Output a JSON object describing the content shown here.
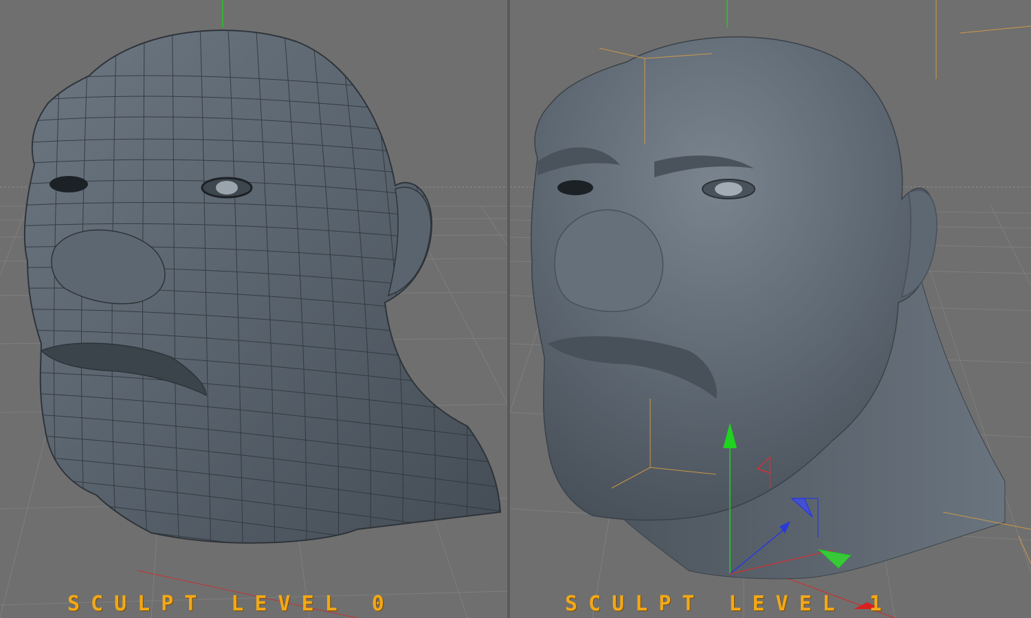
{
  "captions": {
    "left": "SCULPT LEVEL 0",
    "right": "SCULPT LEVEL 1"
  },
  "viewports": {
    "left": {
      "label": "sculpt-level-0-viewport",
      "display": "wireframe"
    },
    "right": {
      "label": "sculpt-level-1-viewport",
      "display": "smooth-shaded"
    }
  },
  "colors": {
    "background": "#6f6f6f",
    "grid": "#8a8a8a",
    "mesh": "#56606a",
    "caption": "#f2a818",
    "axis_y": "#1fd31f",
    "axis_x": "#d23030",
    "axis_z": "#2a3ad8",
    "bounding_box": "#e0a040"
  },
  "icons": {
    "gizmo": "move-axis-gizmo-icon"
  }
}
